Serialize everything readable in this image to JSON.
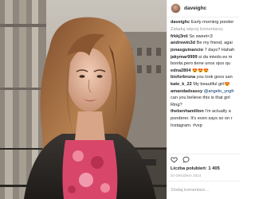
{
  "post": {
    "username": "daveighc",
    "caption_username": "daveighc",
    "caption_text": "Early morning ponder"
  },
  "load_more": "Załaduj więcej komentarzy",
  "comments": [
    {
      "user": "frkkj3nti",
      "text": "So sweet<3"
    },
    {
      "user": "andrewin3d",
      "text": "Be my friend, agai"
    },
    {
      "user": "jonasguinancio",
      "text": "7 days? Hahah"
    },
    {
      "user": "jakymar9999",
      "text": "si da miedo.es m"
    },
    {
      "user": "",
      "text": "bonita.pero tiene unos ojos qu"
    },
    {
      "user": "edna2804",
      "text": "😍😍😍"
    },
    {
      "user": "bisforbruna",
      "text": "you look goos san"
    },
    {
      "user": "kate_k_22",
      "text": "My beautiful girl😍"
    },
    {
      "user": "amandadsassy",
      "text": "@angelo_yngfr",
      "cont": "can you believe this is that girl",
      "cont2": "Ring?"
    },
    {
      "user": "thebenhamilton",
      "text": "I'm actually a",
      "cont": "ponderer. It's even says so on r",
      "cont2": "Instagram. #vxp"
    }
  ],
  "likes": "Liczba polubień: 1 405",
  "date": "20 GRUDNIA 2014",
  "add_comment_placeholder": "Dodaj komentarz...",
  "icons": {
    "like": "heart-icon",
    "comment": "comment-bubble-icon"
  }
}
